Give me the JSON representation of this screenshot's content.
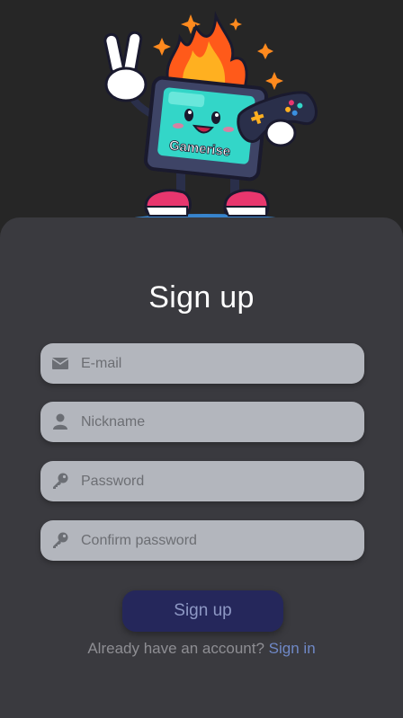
{
  "brand": {
    "logo_text": "Gamerise"
  },
  "form": {
    "title": "Sign up",
    "fields": [
      {
        "placeholder": "E-mail",
        "icon": "envelope-icon"
      },
      {
        "placeholder": "Nickname",
        "icon": "user-icon"
      },
      {
        "placeholder": "Password",
        "icon": "key-icon"
      },
      {
        "placeholder": "Confirm password",
        "icon": "key-icon"
      }
    ],
    "submit_label": "Sign up",
    "account_prompt": "Already have an account?",
    "signin_link": "Sign in"
  },
  "colors": {
    "background": "#262626",
    "card": "#3a3a3f",
    "field": "#b3b6bd",
    "button": "#25275b",
    "button_text": "#8e98c4",
    "link": "#6f88c6"
  }
}
